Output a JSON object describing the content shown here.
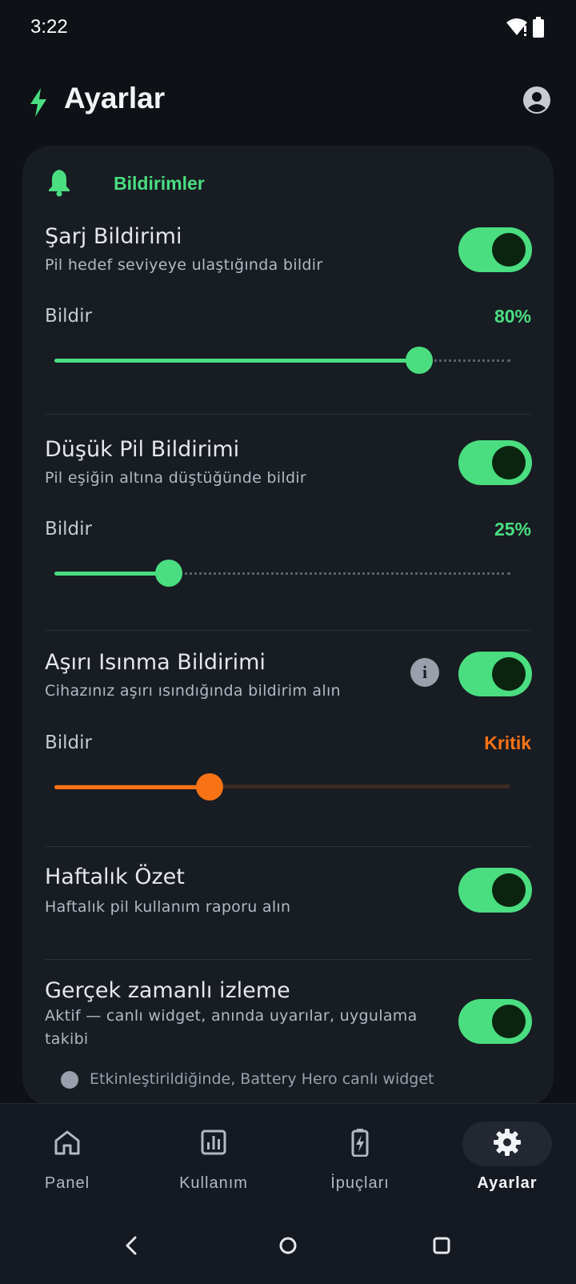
{
  "status_bar": {
    "time": "3:22"
  },
  "header": {
    "title": "Ayarlar",
    "icon": "bolt-icon",
    "profile_icon": "account-circle-icon"
  },
  "colors": {
    "accent_green": "#4ade80",
    "accent_orange": "#f97316",
    "card_bg": "#181c23",
    "page_bg": "#0e1116"
  },
  "section": {
    "title": "Bildirimler",
    "icon": "bell-icon"
  },
  "settings": [
    {
      "title": "Şarj Bildirimi",
      "subtitle": "Pil hedef seviyeye ulaştığında bildir",
      "enabled": true,
      "slider": {
        "label": "Bildir",
        "value_text": "80%",
        "value": 0.8,
        "color": "#4ade80"
      }
    },
    {
      "title": "Düşük Pil Bildirimi",
      "subtitle": "Pil eşiğin altına düştüğünde bildir",
      "enabled": true,
      "slider": {
        "label": "Bildir",
        "value_text": "25%",
        "value": 0.25,
        "color": "#4ade80"
      }
    },
    {
      "title": "Aşırı Isınma Bildirimi",
      "subtitle": "Cihazınız aşırı ısındığında bildirim alın",
      "enabled": true,
      "info_icon": "info-icon",
      "slider": {
        "label": "Bildir",
        "value_text": "Kritik",
        "value": 0.34,
        "color": "#f97316"
      }
    },
    {
      "title": "Haftalık Özet",
      "subtitle": "Haftalık pil kullanım raporu alın",
      "enabled": true
    },
    {
      "title": "Gerçek zamanlı izleme",
      "subtitle": "Aktif — canlı widget, anında uyarılar, uygulama takibi",
      "enabled": true
    }
  ],
  "footnote": "Etkinleştirildiğinde, Battery Hero canlı widget",
  "nav": {
    "items": [
      {
        "label": "Panel",
        "icon": "home-icon",
        "active": false
      },
      {
        "label": "Kullanım",
        "icon": "chart-icon",
        "active": false
      },
      {
        "label": "İpuçları",
        "icon": "battery-charging-icon",
        "active": false
      },
      {
        "label": "Ayarlar",
        "icon": "gear-icon",
        "active": true
      }
    ]
  }
}
